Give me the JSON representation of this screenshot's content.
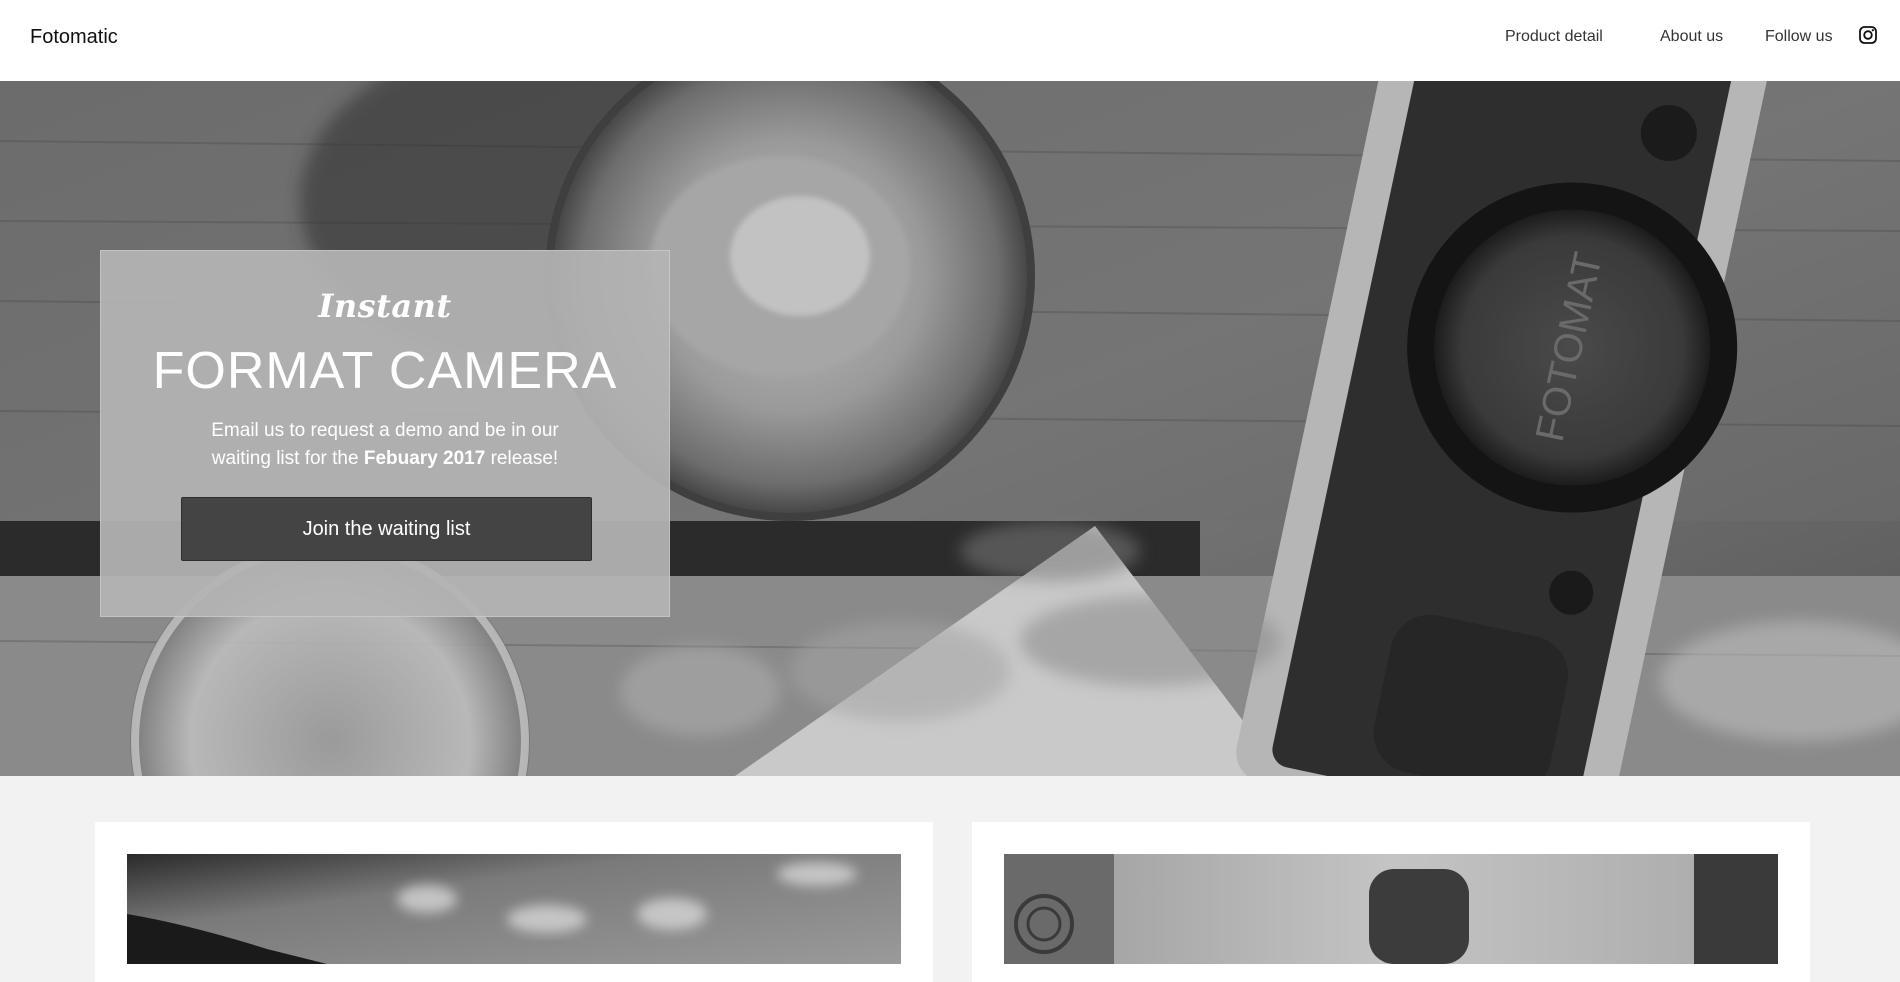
{
  "header": {
    "brand": "Fotomatic",
    "nav": {
      "product_detail": "Product detail",
      "about_us": "About us",
      "follow_us": "Follow us"
    },
    "follow_icon": "instagram-icon"
  },
  "hero": {
    "background": "black-and-white photo of a rangefinder camera on a wooden table next to a bowl",
    "script_title": "Instant",
    "headline": "FORMAT CAMERA",
    "desc_before": "Email us to request a demo and be in our waiting list for the ",
    "desc_strong": "Febuary 2017",
    "desc_after": " release!",
    "cta_label": "Join the waiting list"
  },
  "colors": {
    "header_bg": "#ffffff",
    "page_bg": "#f2f2f2",
    "promo_bg": "#b4b4b4",
    "cta_bg": "#444444",
    "text_light": "#ffffff"
  }
}
